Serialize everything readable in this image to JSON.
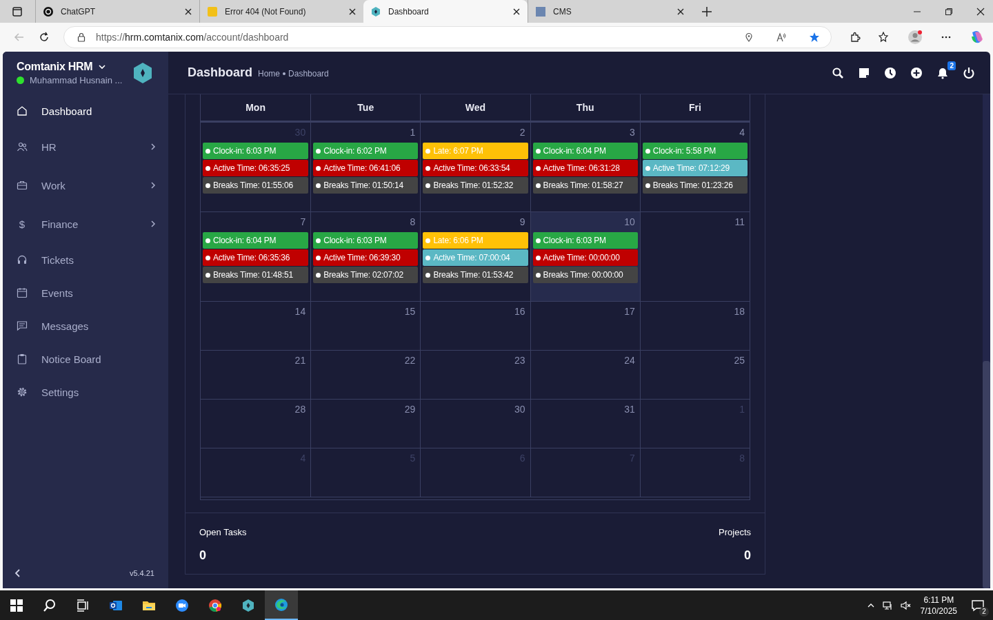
{
  "browser": {
    "tabs": [
      {
        "title": "ChatGPT",
        "kind": "chatgpt",
        "selected": false
      },
      {
        "title": "Error 404 (Not Found)",
        "kind": "yellow",
        "selected": false
      },
      {
        "title": "Dashboard",
        "kind": "app",
        "selected": true
      },
      {
        "title": "CMS",
        "kind": "cms",
        "selected": false
      }
    ],
    "url": {
      "scheme": "https://",
      "host": "hrm.comtanix.com",
      "path": "/account/dashboard"
    }
  },
  "sidebar": {
    "brand": "Comtanix HRM",
    "user": "Muhammad Husnain ...",
    "online": true,
    "items": [
      {
        "label": "Dashboard",
        "selected": true,
        "has_children": false
      },
      {
        "label": "HR",
        "selected": false,
        "has_children": true
      },
      {
        "label": "Work",
        "selected": false,
        "has_children": true
      },
      {
        "label": "Finance",
        "icon_char": "$",
        "selected": false,
        "has_children": true
      },
      {
        "label": "Tickets",
        "selected": false,
        "has_children": false
      },
      {
        "label": "Events",
        "selected": false,
        "has_children": false
      },
      {
        "label": "Messages",
        "selected": false,
        "has_children": false
      },
      {
        "label": "Notice Board",
        "selected": false,
        "has_children": false
      },
      {
        "label": "Settings",
        "selected": false,
        "has_children": false
      }
    ],
    "version": "v5.4.21"
  },
  "header": {
    "title": "Dashboard",
    "breadcrumb": [
      "Home",
      "Dashboard"
    ],
    "notification_count": "2"
  },
  "calendar": {
    "weekdays": [
      "Mon",
      "Tue",
      "Wed",
      "Thu",
      "Fri"
    ],
    "weeks": [
      {
        "days": [
          {
            "date": "30",
            "muted": true,
            "today": false,
            "entries": [
              {
                "label": "Clock-in: 6:03 PM",
                "color": "#28a745"
              },
              {
                "label": "Active Time: 06:35:25",
                "color": "#c00000"
              },
              {
                "label": "Breaks Time: 01:55:06",
                "color": "#444444"
              }
            ]
          },
          {
            "date": "1",
            "muted": false,
            "today": false,
            "entries": [
              {
                "label": "Clock-in: 6:02 PM",
                "color": "#28a745"
              },
              {
                "label": "Active Time: 06:41:06",
                "color": "#c00000"
              },
              {
                "label": "Breaks Time: 01:50:14",
                "color": "#444444"
              }
            ]
          },
          {
            "date": "2",
            "muted": false,
            "today": false,
            "entries": [
              {
                "label": "Late: 6:07 PM",
                "color": "#ffc107"
              },
              {
                "label": "Active Time: 06:33:54",
                "color": "#c00000"
              },
              {
                "label": "Breaks Time: 01:52:32",
                "color": "#444444"
              }
            ]
          },
          {
            "date": "3",
            "muted": false,
            "today": false,
            "entries": [
              {
                "label": "Clock-in: 6:04 PM",
                "color": "#28a745"
              },
              {
                "label": "Active Time: 06:31:28",
                "color": "#c00000"
              },
              {
                "label": "Breaks Time: 01:58:27",
                "color": "#444444"
              }
            ]
          },
          {
            "date": "4",
            "muted": false,
            "today": false,
            "entries": [
              {
                "label": "Clock-in: 5:58 PM",
                "color": "#28a745"
              },
              {
                "label": "Active Time: 07:12:29",
                "color": "#5bb8c4"
              },
              {
                "label": "Breaks Time: 01:23:26",
                "color": "#444444"
              }
            ]
          }
        ]
      },
      {
        "days": [
          {
            "date": "7",
            "muted": false,
            "today": false,
            "entries": [
              {
                "label": "Clock-in: 6:04 PM",
                "color": "#28a745"
              },
              {
                "label": "Active Time: 06:35:36",
                "color": "#c00000"
              },
              {
                "label": "Breaks Time: 01:48:51",
                "color": "#444444"
              }
            ]
          },
          {
            "date": "8",
            "muted": false,
            "today": false,
            "entries": [
              {
                "label": "Clock-in: 6:03 PM",
                "color": "#28a745"
              },
              {
                "label": "Active Time: 06:39:30",
                "color": "#c00000"
              },
              {
                "label": "Breaks Time: 02:07:02",
                "color": "#444444"
              }
            ]
          },
          {
            "date": "9",
            "muted": false,
            "today": false,
            "entries": [
              {
                "label": "Late: 6:06 PM",
                "color": "#ffc107"
              },
              {
                "label": "Active Time: 07:00:04",
                "color": "#5bb8c4"
              },
              {
                "label": "Breaks Time: 01:53:42",
                "color": "#444444"
              }
            ]
          },
          {
            "date": "10",
            "muted": false,
            "today": true,
            "entries": [
              {
                "label": "Clock-in: 6:03 PM",
                "color": "#28a745"
              },
              {
                "label": "Active Time: 00:00:00",
                "color": "#c00000"
              },
              {
                "label": "Breaks Time: 00:00:00",
                "color": "#444444"
              }
            ]
          },
          {
            "date": "11",
            "muted": false,
            "today": false
          }
        ]
      },
      {
        "days": [
          {
            "date": "14",
            "muted": false,
            "today": false
          },
          {
            "date": "15",
            "muted": false,
            "today": false
          },
          {
            "date": "16",
            "muted": false,
            "today": false
          },
          {
            "date": "17",
            "muted": false,
            "today": false
          },
          {
            "date": "18",
            "muted": false,
            "today": false
          }
        ]
      },
      {
        "days": [
          {
            "date": "21",
            "muted": false,
            "today": false
          },
          {
            "date": "22",
            "muted": false,
            "today": false
          },
          {
            "date": "23",
            "muted": false,
            "today": false
          },
          {
            "date": "24",
            "muted": false,
            "today": false
          },
          {
            "date": "25",
            "muted": false,
            "today": false
          }
        ]
      },
      {
        "days": [
          {
            "date": "28",
            "muted": false,
            "today": false
          },
          {
            "date": "29",
            "muted": false,
            "today": false
          },
          {
            "date": "30",
            "muted": false,
            "today": false
          },
          {
            "date": "31",
            "muted": false,
            "today": false
          },
          {
            "date": "1",
            "muted": true,
            "today": false
          }
        ]
      },
      {
        "days": [
          {
            "date": "4",
            "muted": true,
            "today": false
          },
          {
            "date": "5",
            "muted": true,
            "today": false
          },
          {
            "date": "6",
            "muted": true,
            "today": false
          },
          {
            "date": "7",
            "muted": true,
            "today": false
          },
          {
            "date": "8",
            "muted": true,
            "today": false
          }
        ]
      }
    ]
  },
  "stats": [
    {
      "label": "Open Tasks",
      "value": "0"
    },
    {
      "label": "Projects",
      "value": "0"
    }
  ],
  "taskbar": {
    "time": "6:11 PM",
    "date": "7/10/2025",
    "notification_count": "2"
  }
}
